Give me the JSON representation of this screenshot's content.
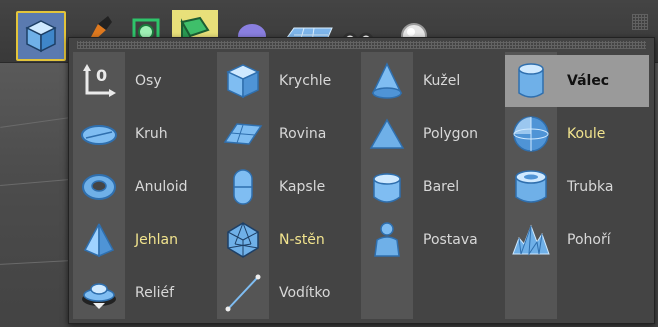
{
  "colors": {
    "icon_light": "#bfe3ff",
    "icon_mid": "#6fb0e8",
    "icon_dark": "#2f6fae",
    "highlight_text": "#f2e48e",
    "selected_bg": "#9a9a9a"
  },
  "toolbar": {
    "icons": [
      "cube-icon",
      "pen-tool-icon",
      "generator-icon",
      "deformer-icon",
      "environment-icon",
      "camera-icon",
      "light-icon"
    ]
  },
  "menu": {
    "columns": [
      [
        {
          "label": "Osy",
          "icon": "axis-icon"
        },
        {
          "label": "Kruh",
          "icon": "disc-icon"
        },
        {
          "label": "Anuloid",
          "icon": "torus-icon"
        },
        {
          "label": "Jehlan",
          "icon": "pyramid-icon",
          "highlight": true
        },
        {
          "label": "Reliéf",
          "icon": "relief-icon"
        }
      ],
      [
        {
          "label": "Krychle",
          "icon": "cube-icon"
        },
        {
          "label": "Rovina",
          "icon": "plane-icon"
        },
        {
          "label": "Kapsle",
          "icon": "capsule-icon"
        },
        {
          "label": "N-stěn",
          "icon": "polyhedron-icon",
          "highlight": true
        },
        {
          "label": "Vodítko",
          "icon": "guide-icon"
        }
      ],
      [
        {
          "label": "Kužel",
          "icon": "cone-icon"
        },
        {
          "label": "Polygon",
          "icon": "polygon-icon"
        },
        {
          "label": "Barel",
          "icon": "oil-tank-icon"
        },
        {
          "label": "Postava",
          "icon": "figure-icon"
        }
      ],
      [
        {
          "label": "Válec",
          "icon": "cylinder-icon",
          "selected": true
        },
        {
          "label": "Koule",
          "icon": "sphere-icon",
          "highlight": true
        },
        {
          "label": "Trubka",
          "icon": "tube-icon"
        },
        {
          "label": "Pohoří",
          "icon": "landscape-icon"
        }
      ]
    ]
  }
}
